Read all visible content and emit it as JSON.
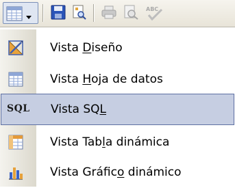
{
  "toolbar": {
    "buttons": [
      {
        "icon": "datasheet-view-icon"
      },
      {
        "icon": "save-icon"
      },
      {
        "icon": "file-search-icon"
      },
      {
        "icon": "print-icon"
      },
      {
        "icon": "print-preview-icon"
      },
      {
        "icon": "spelling-icon"
      }
    ]
  },
  "menu": {
    "items": [
      {
        "pre": "Vista ",
        "u": "D",
        "post": "iseño",
        "icon": "design-view-icon"
      },
      {
        "pre": "Vista ",
        "u": "H",
        "post": "oja de datos",
        "icon": "datasheet-view-icon"
      },
      {
        "pre": "Vista SQ",
        "u": "L",
        "post": "",
        "icon": "sql-view-icon",
        "icon_text": "SQL",
        "highlighted": true
      },
      {
        "pre": "Vista Tab",
        "u": "l",
        "post": "a dinámica",
        "icon": "pivot-table-icon"
      },
      {
        "pre": "Vista Gráfic",
        "u": "o",
        "post": " dinámico",
        "icon": "pivot-chart-icon"
      }
    ]
  },
  "colors": {
    "highlight": "#c6cee2",
    "highlight_border": "#5d6fa2"
  }
}
